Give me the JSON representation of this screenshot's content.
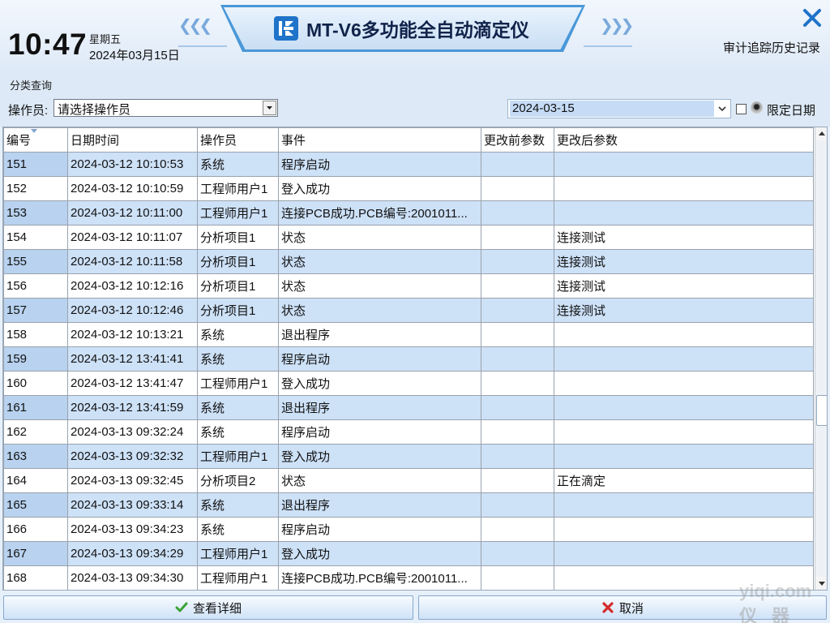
{
  "header": {
    "time": "10:47",
    "weekday": "星期五",
    "date": "2024年03月15日",
    "app_title": "MT-V6多功能全自动滴定仪",
    "window_title": "审计追踪历史记录",
    "close_icon": "close-icon",
    "logo_icon": "instrument-logo-icon",
    "accent_color": "#1f73c9"
  },
  "filter": {
    "title": "分类查询",
    "operator_label": "操作员:",
    "operator_value": "请选择操作员",
    "date_value": "2024-03-15",
    "limit_date_label": "限定日期",
    "limit_date_checked": false
  },
  "table": {
    "columns": [
      "编号",
      "日期时间",
      "操作员",
      "事件",
      "更改前参数",
      "更改后参数"
    ],
    "rows": [
      [
        "151",
        "2024-03-12 10:10:53",
        "系统",
        "程序启动",
        "",
        ""
      ],
      [
        "152",
        "2024-03-12 10:10:59",
        "工程师用户1",
        "登入成功",
        "",
        ""
      ],
      [
        "153",
        "2024-03-12 10:11:00",
        "工程师用户1",
        "连接PCB成功.PCB编号:2001011...",
        "",
        ""
      ],
      [
        "154",
        "2024-03-12 10:11:07",
        "分析项目1",
        "状态",
        "",
        "连接测试"
      ],
      [
        "155",
        "2024-03-12 10:11:58",
        "分析项目1",
        "状态",
        "",
        "连接测试"
      ],
      [
        "156",
        "2024-03-12 10:12:16",
        "分析项目1",
        "状态",
        "",
        "连接测试"
      ],
      [
        "157",
        "2024-03-12 10:12:46",
        "分析项目1",
        "状态",
        "",
        "连接测试"
      ],
      [
        "158",
        "2024-03-12 10:13:21",
        "系统",
        "退出程序",
        "",
        ""
      ],
      [
        "159",
        "2024-03-12 13:41:41",
        "系统",
        "程序启动",
        "",
        ""
      ],
      [
        "160",
        "2024-03-12 13:41:47",
        "工程师用户1",
        "登入成功",
        "",
        ""
      ],
      [
        "161",
        "2024-03-12 13:41:59",
        "系统",
        "退出程序",
        "",
        ""
      ],
      [
        "162",
        "2024-03-13 09:32:24",
        "系统",
        "程序启动",
        "",
        ""
      ],
      [
        "163",
        "2024-03-13 09:32:32",
        "工程师用户1",
        "登入成功",
        "",
        ""
      ],
      [
        "164",
        "2024-03-13 09:32:45",
        "分析项目2",
        "状态",
        "",
        "正在滴定"
      ],
      [
        "165",
        "2024-03-13 09:33:14",
        "系统",
        "退出程序",
        "",
        ""
      ],
      [
        "166",
        "2024-03-13 09:34:23",
        "系统",
        "程序启动",
        "",
        ""
      ],
      [
        "167",
        "2024-03-13 09:34:29",
        "工程师用户1",
        "登入成功",
        "",
        ""
      ],
      [
        "168",
        "2024-03-13 09:34:30",
        "工程师用户1",
        "连接PCB成功.PCB编号:2001011...",
        "",
        ""
      ]
    ],
    "row_colors": {
      "even": "#ffffff",
      "odd": "#cde1f7"
    }
  },
  "buttons": {
    "detail_label": "查看详细",
    "cancel_label": "取消",
    "detail_icon": "check-icon",
    "cancel_icon": "x-icon"
  },
  "watermark": {
    "line1": "yiqi.com",
    "line2": "仪器网"
  }
}
